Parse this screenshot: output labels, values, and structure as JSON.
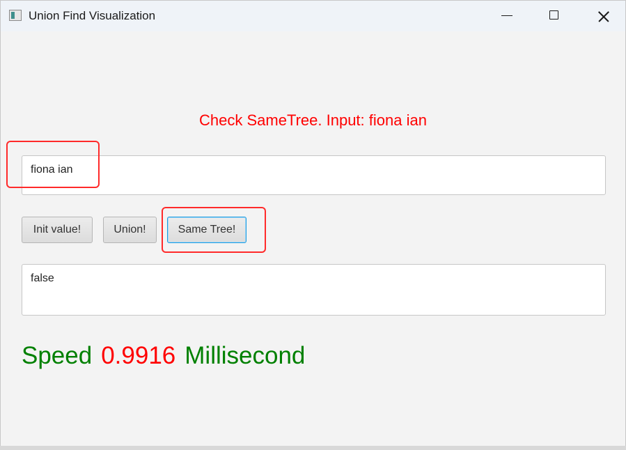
{
  "window": {
    "title": "Union Find Visualization",
    "icon": "app-icon"
  },
  "status": {
    "text": "Check SameTree. Input: fiona ian",
    "color": "#ff0000"
  },
  "input": {
    "value": "fiona ian"
  },
  "buttons": {
    "init_label": "Init value!",
    "union_label": "Union!",
    "same_tree_label": "Same Tree!"
  },
  "output": {
    "value": "false"
  },
  "speed": {
    "label": "Speed",
    "value": "0.9916",
    "unit": "Millisecond",
    "label_color": "#008000",
    "value_color": "#ff0000"
  }
}
